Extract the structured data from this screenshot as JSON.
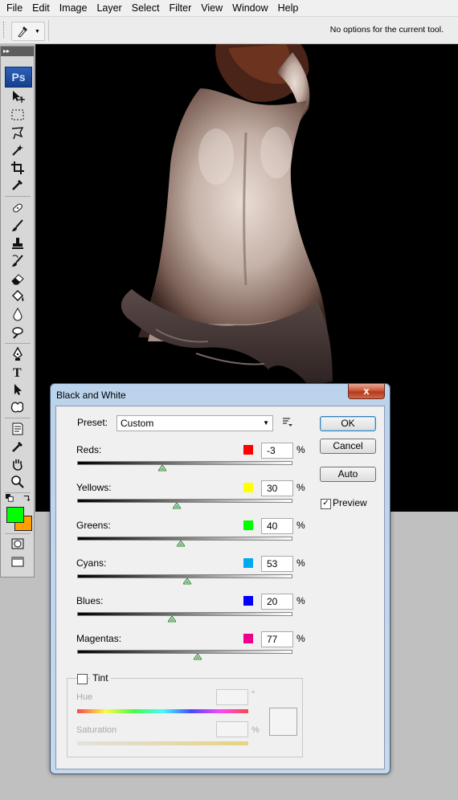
{
  "menubar": {
    "items": [
      "File",
      "Edit",
      "Image",
      "Layer",
      "Select",
      "Filter",
      "View",
      "Window",
      "Help"
    ]
  },
  "options_bar": {
    "message": "No options for the current tool."
  },
  "toolbox": {
    "logo": "Ps",
    "foreground_color": "#00ff00",
    "background_color": "#ff9f00",
    "tools": [
      "move-icon",
      "marquee-icon",
      "lasso-icon",
      "magic-wand-icon",
      "crop-icon",
      "eyedropper-icon",
      "healing-brush-icon",
      "brush-icon",
      "clone-stamp-icon",
      "history-brush-icon",
      "eraser-icon",
      "paint-bucket-icon",
      "blur-icon",
      "dodge-icon",
      "pen-icon",
      "type-icon",
      "path-selection-icon",
      "custom-shape-icon",
      "notes-icon",
      "eyedropper-icon",
      "hand-icon",
      "zoom-icon"
    ]
  },
  "dialog": {
    "title": "Black and White",
    "close_label": "x",
    "preset_label": "Preset:",
    "preset_value": "Custom",
    "buttons": {
      "ok": "OK",
      "cancel": "Cancel",
      "auto": "Auto"
    },
    "preview_label": "Preview",
    "preview_checked": true,
    "percent_symbol": "%",
    "channels": [
      {
        "label": "Reds:",
        "value": "-3",
        "color": "#ff0000",
        "slider_fraction": 0.396
      },
      {
        "label": "Yellows:",
        "value": "30",
        "color": "#ffff00",
        "slider_fraction": 0.462
      },
      {
        "label": "Greens:",
        "value": "40",
        "color": "#00ff00",
        "slider_fraction": 0.483
      },
      {
        "label": "Cyans:",
        "value": "53",
        "color": "#00aaee",
        "slider_fraction": 0.51
      },
      {
        "label": "Blues:",
        "value": "20",
        "color": "#0000ff",
        "slider_fraction": 0.441
      },
      {
        "label": "Magentas:",
        "value": "77",
        "color": "#ee0088",
        "slider_fraction": 0.56
      }
    ],
    "tint": {
      "label": "Tint",
      "checked": false,
      "hue_label": "Hue",
      "hue_unit": "°",
      "saturation_label": "Saturation",
      "saturation_unit": "%"
    }
  }
}
